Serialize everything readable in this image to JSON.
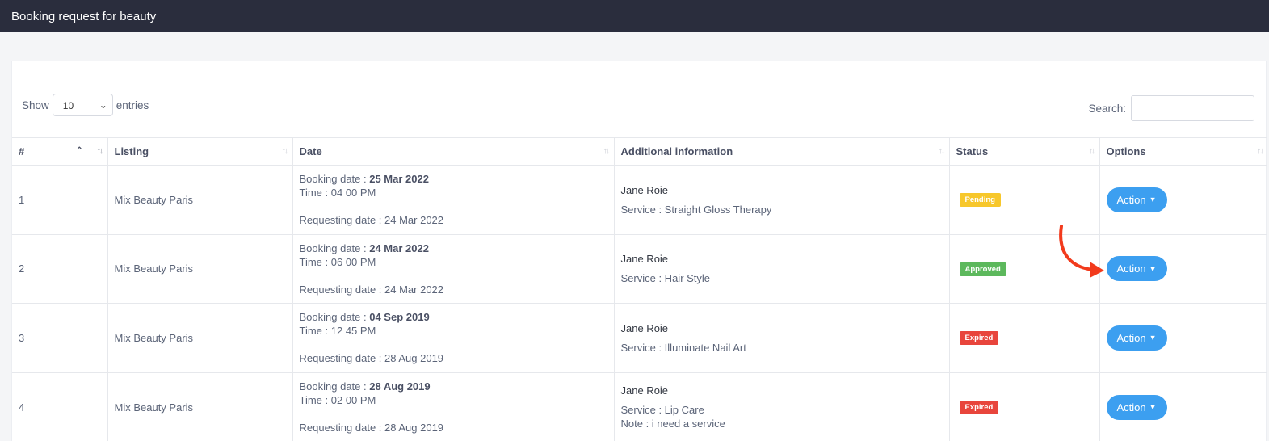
{
  "header": {
    "title": "Booking request for beauty"
  },
  "controls": {
    "show_label": "Show",
    "entries_value": "10",
    "entries_label": "entries",
    "search_label": "Search:"
  },
  "table": {
    "headers": [
      "#",
      "Listing",
      "Date",
      "Additional information",
      "Status",
      "Options"
    ],
    "rows": [
      {
        "num": "1",
        "listing": "Mix Beauty Paris",
        "booking_prefix": "Booking date : ",
        "booking_date": "25 Mar 2022",
        "time": "Time : 04 00 PM",
        "requesting": "Requesting date : 24 Mar 2022",
        "name": "Jane Roie",
        "service": "Service : Straight Gloss Therapy",
        "note": "",
        "status": "Pending",
        "action": "Action"
      },
      {
        "num": "2",
        "listing": "Mix Beauty Paris",
        "booking_prefix": "Booking date : ",
        "booking_date": "24 Mar 2022",
        "time": "Time : 06 00 PM",
        "requesting": "Requesting date : 24 Mar 2022",
        "name": "Jane Roie",
        "service": "Service : Hair Style",
        "note": "",
        "status": "Approved",
        "action": "Action"
      },
      {
        "num": "3",
        "listing": "Mix Beauty Paris",
        "booking_prefix": "Booking date : ",
        "booking_date": "04 Sep 2019",
        "time": "Time : 12 45 PM",
        "requesting": "Requesting date : 28 Aug 2019",
        "name": "Jane Roie",
        "service": "Service : Illuminate Nail Art",
        "note": "",
        "status": "Expired",
        "action": "Action"
      },
      {
        "num": "4",
        "listing": "Mix Beauty Paris",
        "booking_prefix": "Booking date : ",
        "booking_date": "28 Aug 2019",
        "time": "Time : 02 00 PM",
        "requesting": "Requesting date : 28 Aug 2019",
        "name": "Jane Roie",
        "service": "Service : Lip Care",
        "note": "Note : i need a service",
        "status": "Expired",
        "action": "Action"
      }
    ]
  },
  "colors": {
    "topbar": "#2a2d3d",
    "pending": "#f7c72b",
    "approved": "#5cb85c",
    "expired": "#e8453c",
    "action": "#3c9ff0",
    "annotation_arrow": "#f23a1c"
  },
  "icons": {
    "sort": "sort-arrows-icon",
    "dropdown": "caret-down-icon",
    "annotation": "curved-arrow-icon"
  }
}
